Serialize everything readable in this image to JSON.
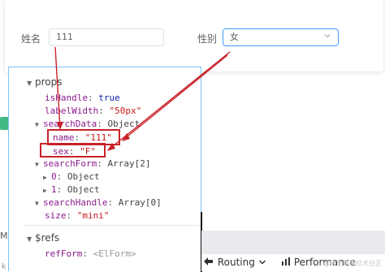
{
  "form": {
    "name_label": "姓名",
    "name_value": "111",
    "sex_label": "性别",
    "sex_value": "女"
  },
  "devtools": {
    "props": {
      "label": "props",
      "isHandle": {
        "key": "isHandle",
        "value": "true"
      },
      "labelWidth": {
        "key": "labelWidth",
        "value": "\"50px\""
      },
      "searchData": {
        "key": "searchData",
        "type": "Object"
      },
      "name": {
        "key": "name",
        "value": "\"111\""
      },
      "sex": {
        "key": "sex",
        "value": "\"F\""
      },
      "searchForm": {
        "key": "searchForm",
        "type": "Array[2]"
      },
      "item0": {
        "key": "0",
        "type": "Object"
      },
      "item1": {
        "key": "1",
        "type": "Object"
      },
      "searchHandle": {
        "key": "searchHandle",
        "type": "Array[0]"
      },
      "size": {
        "key": "size",
        "value": "\"mini\""
      }
    },
    "refs": {
      "label": "$refs",
      "refForm": {
        "key": "refForm",
        "value": "<ElForm>"
      }
    }
  },
  "toolbar": {
    "routing_label": "Routing",
    "performance_label": "Performance"
  },
  "edge": {
    "m": "M",
    "k": "k"
  },
  "watermark": "@稀土掘金技术社区",
  "colors": {
    "accent": "#409eff",
    "vue_green": "#42b983",
    "highlight": "#c8222a"
  }
}
